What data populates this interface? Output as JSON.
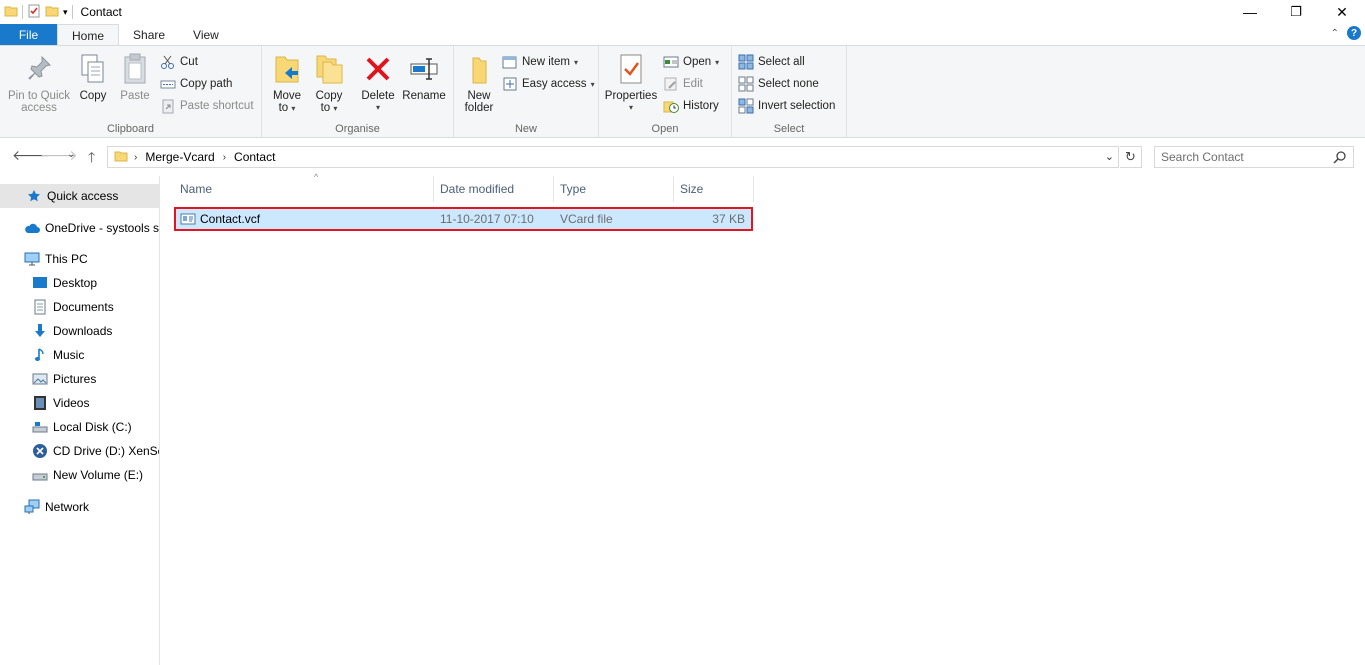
{
  "window": {
    "title": "Contact",
    "controls": {
      "minimize": "—",
      "restore": "❐",
      "close": "✕"
    }
  },
  "tabs": {
    "file": "File",
    "items": [
      {
        "label": "Home",
        "active": true
      },
      {
        "label": "Share",
        "active": false
      },
      {
        "label": "View",
        "active": false
      }
    ]
  },
  "ribbon": {
    "clipboard": {
      "label": "Clipboard",
      "pin_line1": "Pin to Quick",
      "pin_line2": "access",
      "copy": "Copy",
      "paste": "Paste",
      "cut": "Cut",
      "copy_path": "Copy path",
      "paste_shortcut": "Paste shortcut"
    },
    "organise": {
      "label": "Organise",
      "move_line1": "Move",
      "move_line2": "to",
      "copy_line1": "Copy",
      "copy_line2": "to",
      "delete": "Delete",
      "rename": "Rename"
    },
    "new": {
      "label": "New",
      "folder_line1": "New",
      "folder_line2": "folder",
      "new_item": "New item",
      "easy_access": "Easy access"
    },
    "open": {
      "label": "Open",
      "properties": "Properties",
      "open": "Open",
      "edit": "Edit",
      "history": "History"
    },
    "select": {
      "label": "Select",
      "select_all": "Select all",
      "select_none": "Select none",
      "invert_selection": "Invert selection"
    }
  },
  "address": {
    "crumbs": [
      "Merge-Vcard",
      "Contact"
    ],
    "search_placeholder": "Search Contact"
  },
  "nav": {
    "items": [
      {
        "label": "Quick access",
        "icon": "star-icon"
      },
      {
        "label": "OneDrive - systools software",
        "icon": "cloud-icon"
      },
      {
        "label": "This PC",
        "icon": "computer-icon"
      },
      {
        "label": "Desktop",
        "icon": "desktop-icon"
      },
      {
        "label": "Documents",
        "icon": "documents-icon"
      },
      {
        "label": "Downloads",
        "icon": "downloads-icon"
      },
      {
        "label": "Music",
        "icon": "music-icon"
      },
      {
        "label": "Pictures",
        "icon": "pictures-icon"
      },
      {
        "label": "Videos",
        "icon": "videos-icon"
      },
      {
        "label": "Local Disk (C:)",
        "icon": "disk-icon"
      },
      {
        "label": "CD Drive (D:) XenServer",
        "icon": "cd-drive-icon"
      },
      {
        "label": "New Volume (E:)",
        "icon": "volume-icon"
      },
      {
        "label": "Network",
        "icon": "network-icon"
      }
    ]
  },
  "files": {
    "columns": [
      "Name",
      "Date modified",
      "Type",
      "Size"
    ],
    "rows": [
      {
        "name": "Contact.vcf",
        "date": "11-10-2017 07:10",
        "type": "VCard file",
        "size": "37 KB"
      }
    ]
  },
  "colors": {
    "accent": "#1979ca",
    "selection": "#cce8ff",
    "highlight_border": "#e3151f"
  }
}
